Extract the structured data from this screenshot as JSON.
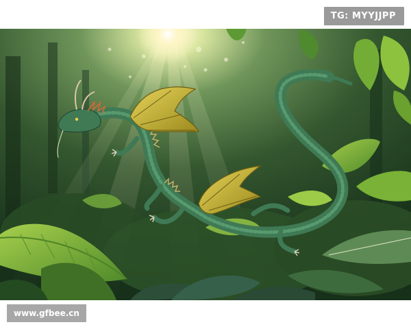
{
  "overlay": {
    "tag_text": "TG: MYYJJPP",
    "site_text": "www.gfbee.cn"
  },
  "scene": {
    "subject": "green winged dragon",
    "setting": "sunlit jungle",
    "colors": {
      "foliage_dark": "#1c3a1d",
      "foliage_light": "#7fb23a",
      "dragon_body": "#3f7a55",
      "dragon_wing": "#c9b32a",
      "sun": "#fff6c8"
    }
  }
}
